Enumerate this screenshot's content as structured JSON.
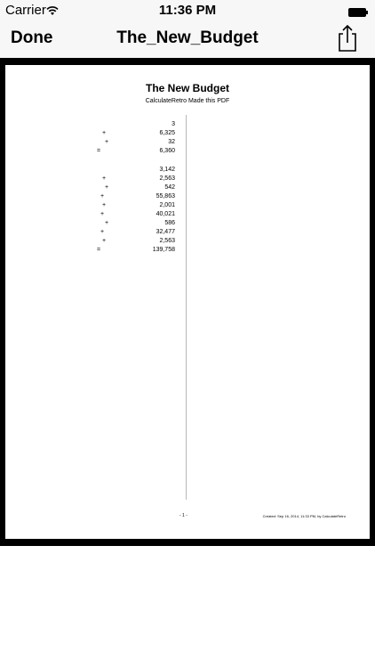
{
  "status_bar": {
    "carrier": "Carrier",
    "time": "11:36 PM",
    "icons": [
      "wifi-icon",
      "battery-icon"
    ]
  },
  "nav_bar": {
    "done_label": "Done",
    "title": "The_New_Budget",
    "share_icon": "share-icon"
  },
  "document": {
    "title": "The New Budget",
    "subtitle": "CalculateRetro Made this PDF",
    "tape": [
      {
        "op": "",
        "value": "3"
      },
      {
        "op": "+",
        "value": "6,325"
      },
      {
        "op": "+",
        "value": "32"
      },
      {
        "op": "=",
        "value": "6,360"
      },
      {
        "op": "",
        "value": ""
      },
      {
        "op": "",
        "value": "3,142"
      },
      {
        "op": "+",
        "value": "2,563"
      },
      {
        "op": "+",
        "value": "542"
      },
      {
        "op": "+",
        "value": "55,863"
      },
      {
        "op": "+",
        "value": "2,001"
      },
      {
        "op": "+",
        "value": "40,021"
      },
      {
        "op": "+",
        "value": "586"
      },
      {
        "op": "+",
        "value": "32,477"
      },
      {
        "op": "+",
        "value": "2,563"
      },
      {
        "op": "=",
        "value": "139,758"
      }
    ],
    "page_number": "- 1 -",
    "created": "Created: Sep 16, 2014, 11:33 PM, by CalculateRetro"
  },
  "colors": {
    "bar_background": "#f7f7f7",
    "viewer_background": "#000000",
    "page_background": "#ffffff"
  }
}
